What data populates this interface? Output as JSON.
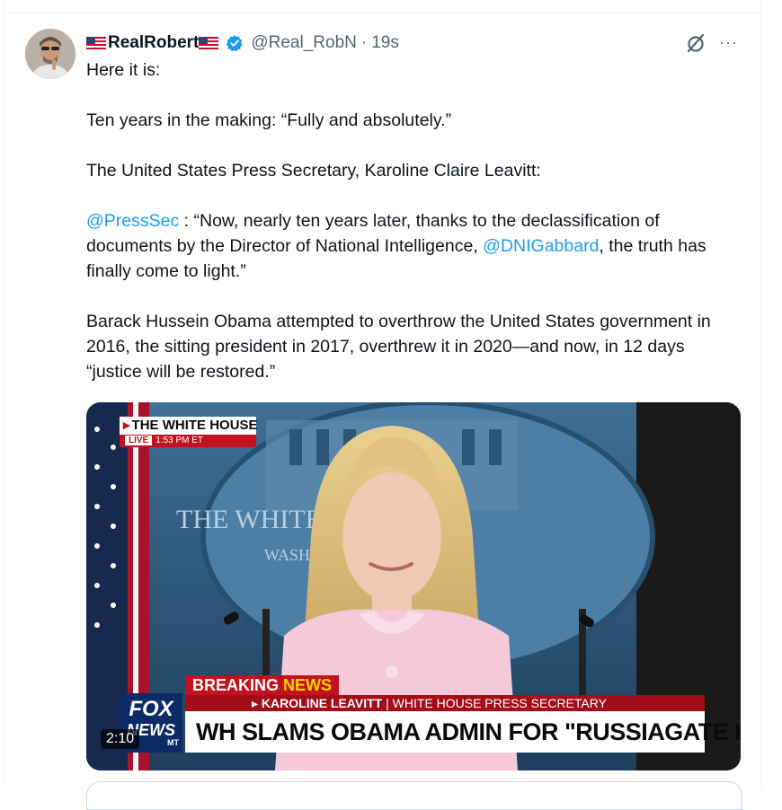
{
  "tweet": {
    "author": {
      "name": "RealRobert",
      "handle": "@Real_RobN",
      "verified": true,
      "flag_emoji": "us-flag"
    },
    "separator": "·",
    "time": "19s",
    "icons": [
      "grok-icon",
      "more-icon"
    ],
    "more_label": "···",
    "text": {
      "line1": "Here it is:",
      "para2": "Ten years in the making: “Fully and absolutely.”",
      "para3": "The United States Press Secretary, Karoline Claire Leavitt:",
      "para4_mention1": "@PressSec",
      "para4_a": " : “Now, nearly ten years later, thanks to the declassification of documents by the Director of National Intelligence, ",
      "para4_mention2": "@DNIGabbard",
      "para4_b": ", the truth has finally come to light.”",
      "para5": "Barack Hussein Obama attempted to overthrow the United States government in 2016, the sitting president in 2017, overthrew it in 2020—and now, in 12 days “justice will be restored.”"
    },
    "video": {
      "duration": "2:10",
      "chyron_wh_arrow": "▸",
      "chyron_wh": "THE WHITE HOUSE",
      "chyron_live": "LIVE",
      "chyron_time": "1:53 PM ET",
      "breaking": "BREAKING ",
      "breaking_news": "NEWS",
      "sub_name": "▸ KAROLINE LEAVITT",
      "sub_role": " | WHITE HOUSE PRESS SECRETARY",
      "headline": "WH SLAMS OBAMA ADMIN FOR \"RUSSIAGATE HOAX\"",
      "logo_fox": "FOX",
      "logo_news": "NEWS",
      "logo_mt": "MT",
      "backdrop_text": "THE WHITE HOUSE",
      "backdrop_sub": "WASHINGTON"
    }
  },
  "colors": {
    "link": "#1d9bf0",
    "secondary": "#536471",
    "verified": "#1d9bf0",
    "fox_red": "#c1121f",
    "fox_blue": "#0b2a66"
  }
}
